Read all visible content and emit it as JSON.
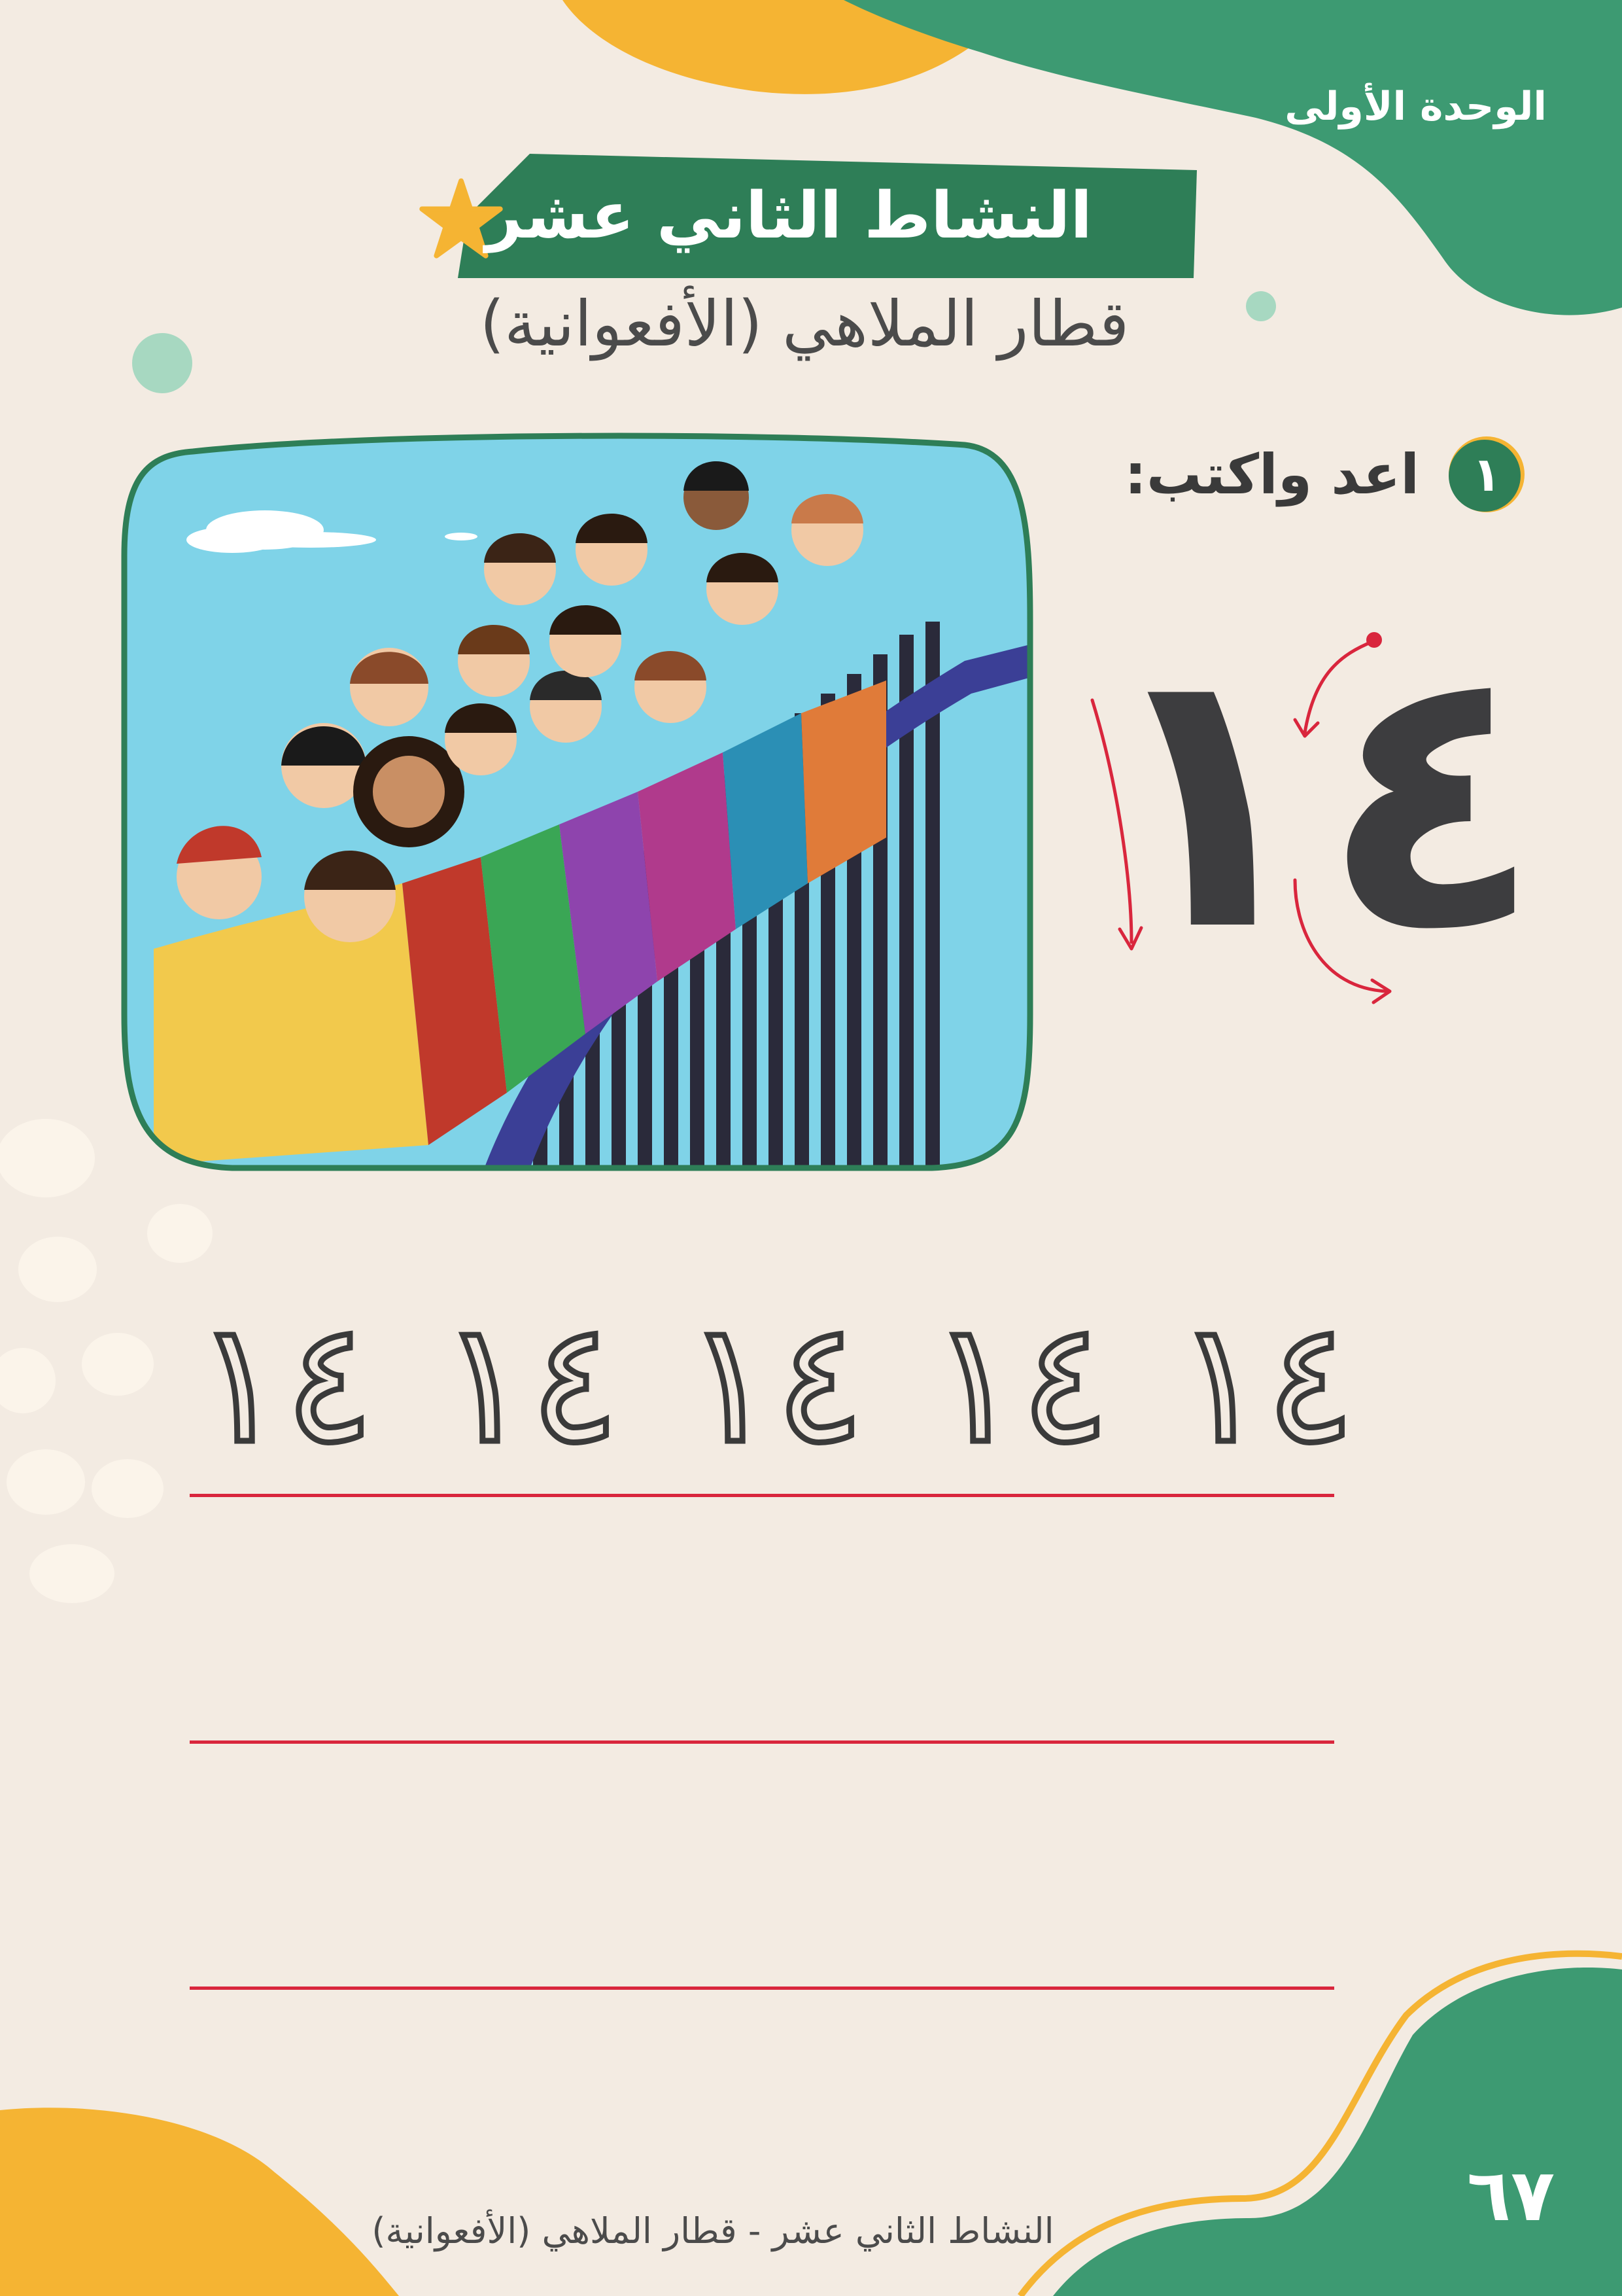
{
  "colors": {
    "background": "#f3ebe2",
    "brand_green": "#3d9a72",
    "dark_green": "#2e7e57",
    "accent_orange": "#f5b433",
    "line_red": "#d9263d",
    "text_dark": "#3d3d3f"
  },
  "header": {
    "unit_label": "الوحدة الأولى",
    "activity_title": "النشاط الثاني عشر",
    "star_icon": "star-icon",
    "subtitle": "قطار الملاهي (الأفعوانية)"
  },
  "illustration": {
    "icon": "roller-coaster-children-illustration"
  },
  "exercise": {
    "number": "١",
    "instruction": "اعد واكتب:",
    "model_number": "١٤",
    "stroke_arrows_icon": "writing-direction-arrows-icon",
    "trace_items": [
      "١٤",
      "١٤",
      "١٤",
      "١٤",
      "١٤"
    ]
  },
  "footer": {
    "page_number": "٦٧",
    "text": "النشاط الثاني عشر - قطار الملاهي (الأفعوانية)"
  }
}
